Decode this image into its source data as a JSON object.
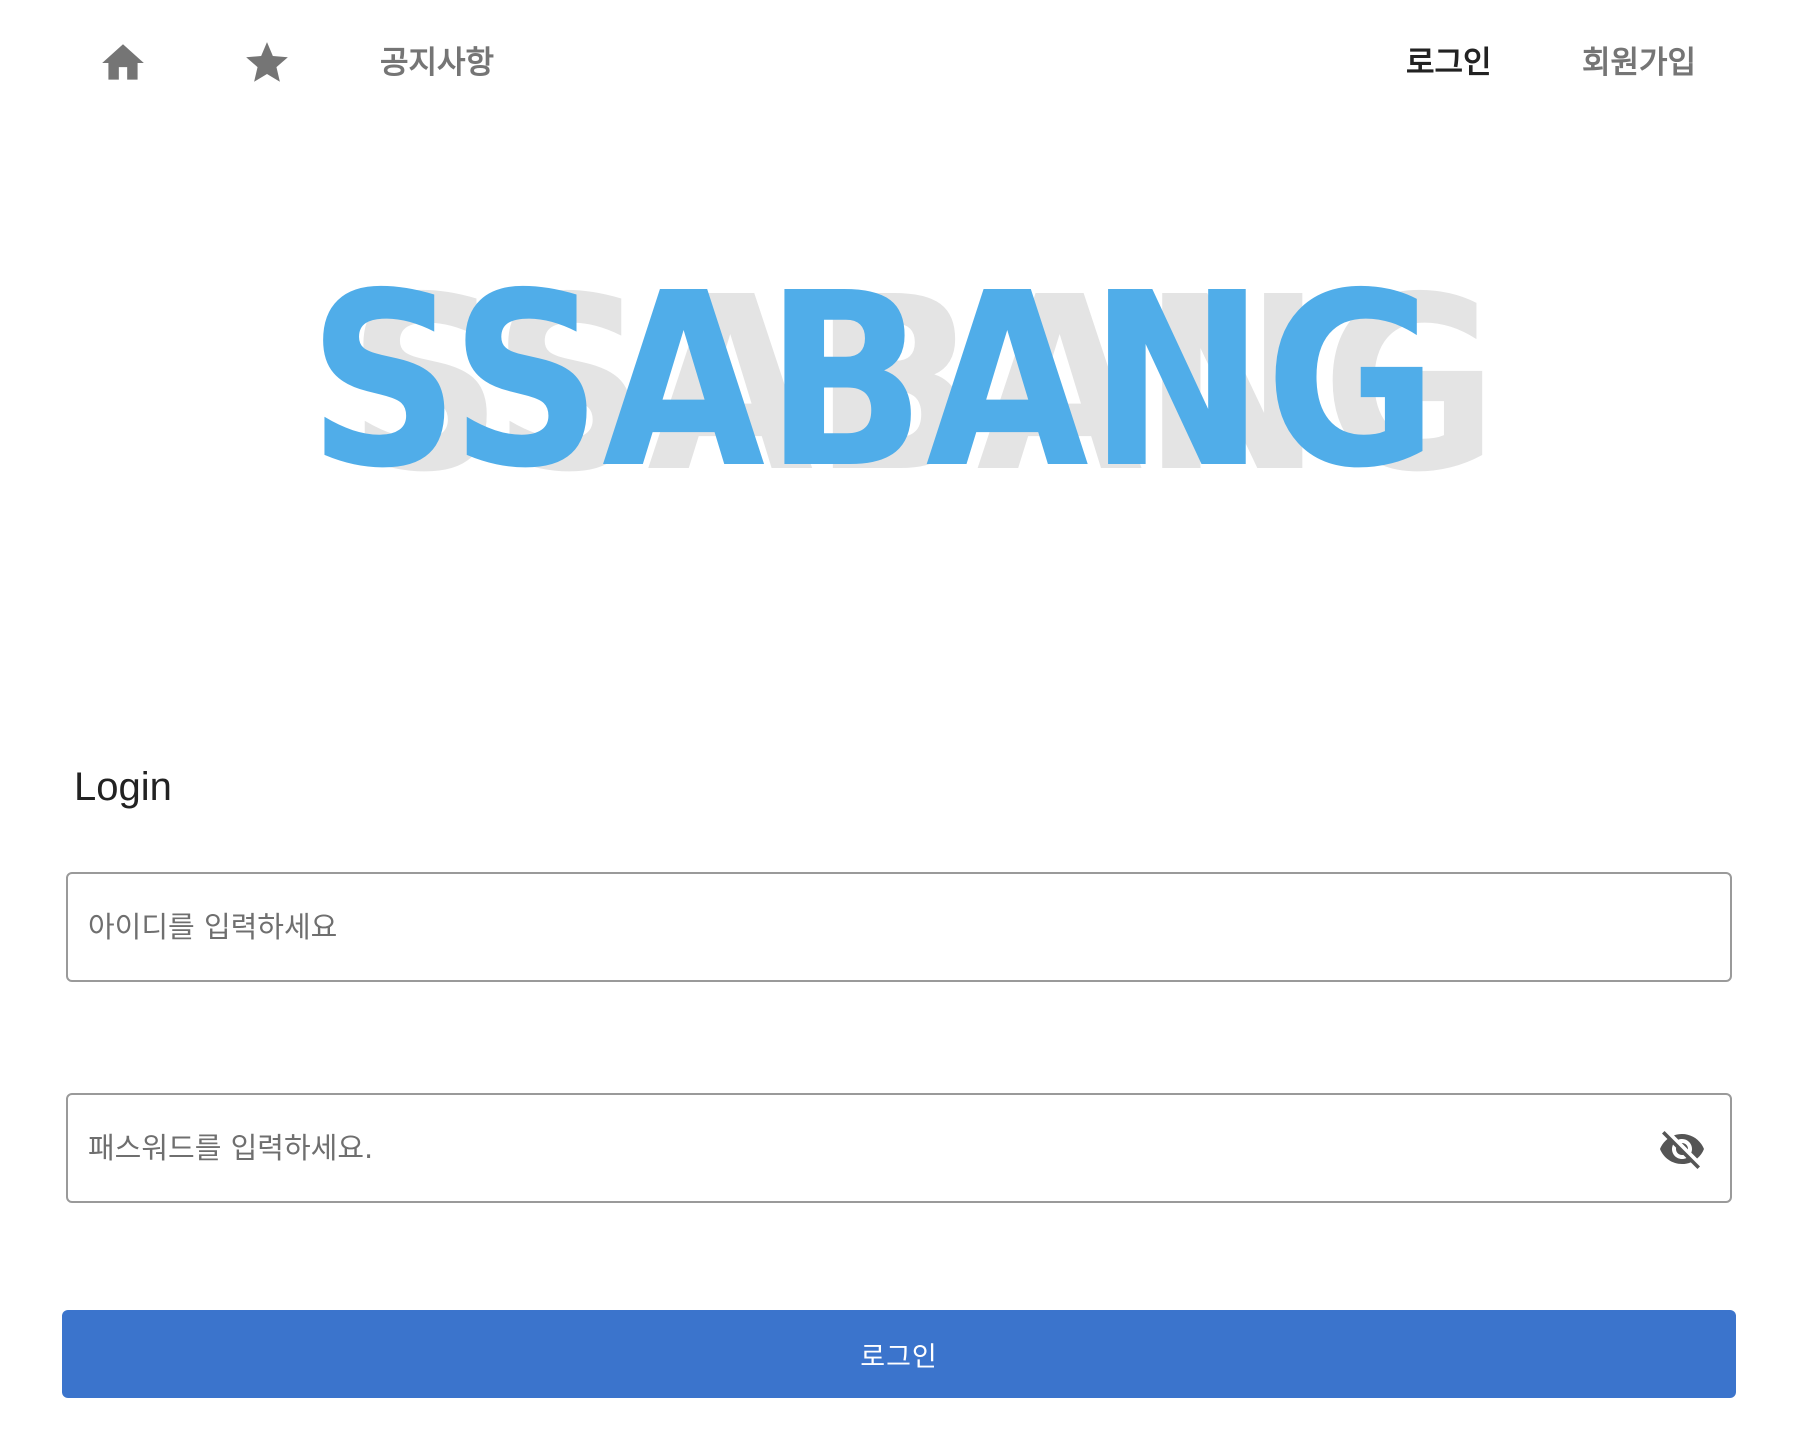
{
  "nav": {
    "home_icon": "home-icon",
    "favorites_icon": "star-icon",
    "notice_label": "공지사항",
    "login_label": "로그인",
    "signup_label": "회원가입",
    "active": "login",
    "colors": {
      "inactive": "#757575",
      "active": "#222222"
    }
  },
  "logo": {
    "text": "SSABANG",
    "front_color": "#50ade9",
    "shadow_color": "#e4e4e4"
  },
  "login": {
    "title": "Login",
    "id_field": {
      "value": "",
      "placeholder": "아이디를 입력하세요"
    },
    "password_field": {
      "value": "",
      "placeholder": "패스워드를 입력하세요.",
      "visibility_icon": "eye-off-icon"
    },
    "submit_label": "로그인",
    "button_color": "#3b74cc"
  }
}
